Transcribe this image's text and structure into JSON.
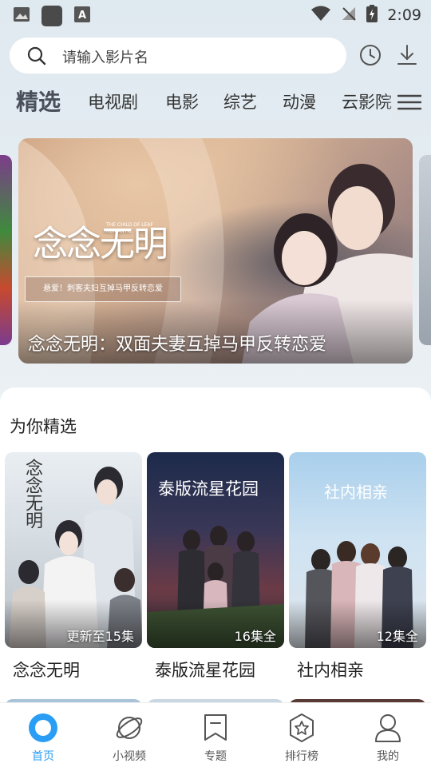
{
  "status_bar": {
    "time": "2:09"
  },
  "search": {
    "placeholder": "请输入影片名"
  },
  "tabs": [
    {
      "label": "精选",
      "active": true
    },
    {
      "label": "电视剧"
    },
    {
      "label": "电影"
    },
    {
      "label": "综艺"
    },
    {
      "label": "动漫"
    },
    {
      "label": "云影院"
    }
  ],
  "banner": {
    "caption": "念念无明：双面夫妻互掉马甲反转恋爱",
    "logo": "念念无明",
    "logo_sub": "THE CHILD OF LEAF ROMANTIC",
    "tagline": "悬爱！刺客夫妇互掉马甲反转恋爱"
  },
  "section": {
    "title": "为你精选",
    "items": [
      {
        "title": "念念无明",
        "badge": "更新至15集",
        "poster_art": "念念无明"
      },
      {
        "title": "泰版流星花园",
        "badge": "16集全",
        "poster_art": "泰版流星花园"
      },
      {
        "title": "社内相亲",
        "badge": "12集全",
        "poster_art": "社内相亲"
      }
    ]
  },
  "bottom_nav": [
    {
      "label": "首页",
      "icon": "home-icon",
      "active": true
    },
    {
      "label": "小视频",
      "icon": "planet-icon"
    },
    {
      "label": "专题",
      "icon": "bookmark-icon"
    },
    {
      "label": "排行榜",
      "icon": "ranking-icon"
    },
    {
      "label": "我的",
      "icon": "profile-icon"
    }
  ],
  "colors": {
    "accent": "#2a9df4",
    "active_tab": "#4a4f5a"
  }
}
